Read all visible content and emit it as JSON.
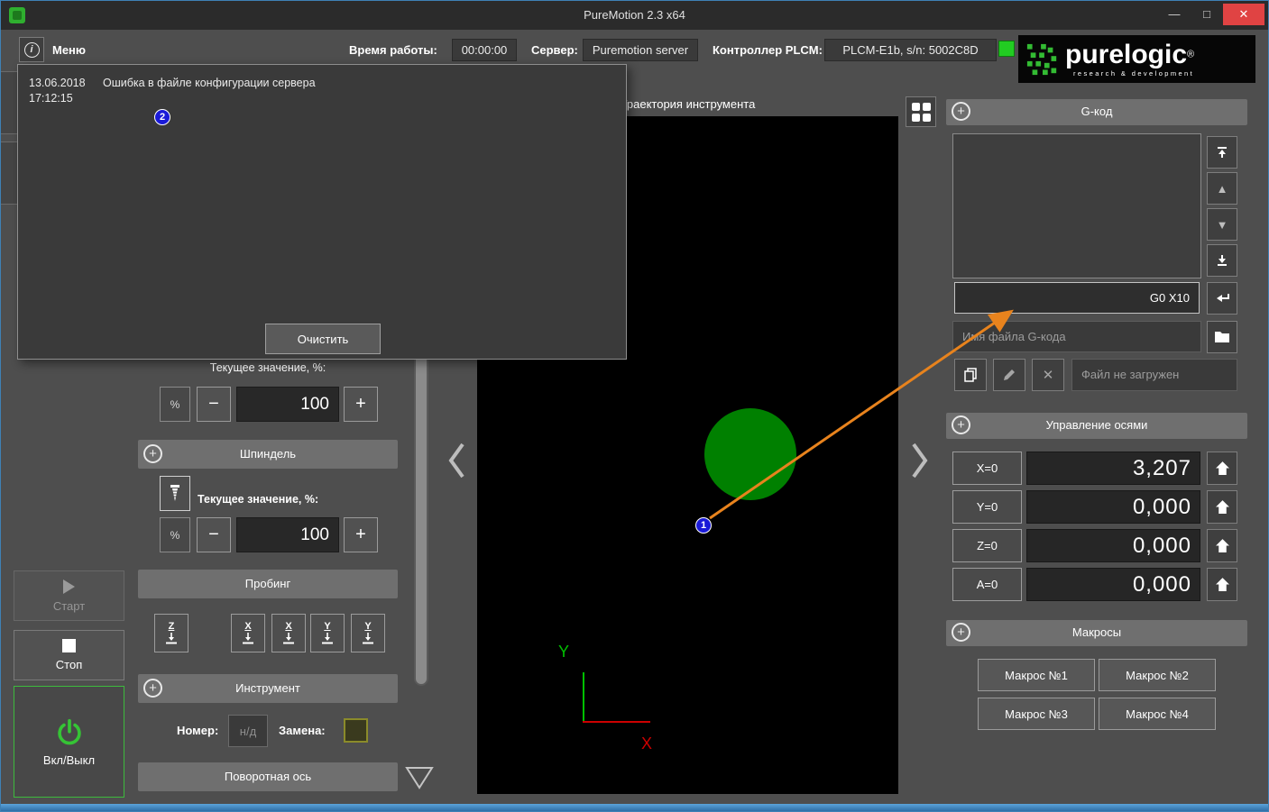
{
  "window": {
    "title": "PureMotion 2.3 x64",
    "controls": {
      "minimize": "—",
      "maximize": "□",
      "close": "✕"
    }
  },
  "icons": {
    "plus": "+",
    "minus": "−",
    "info": "i",
    "up_triangle": "▲",
    "down_triangle": "▼",
    "x_mark": "✕"
  },
  "topbar": {
    "menu_label": "Меню",
    "uptime_label": "Время работы:",
    "uptime_value": "00:00:00",
    "server_label": "Сервер:",
    "server_value": "Puremotion server",
    "controller_label": "Контроллер PLCM:",
    "controller_value": "PLCM-E1b, s/n: 5002C8D"
  },
  "logo": {
    "wordmark": "purelogic",
    "reg": "®",
    "subtitle": "research & development"
  },
  "log_panel": {
    "entry_date": "13.06.2018",
    "entry_time": "17:12:15",
    "entry_text": "Ошибка в файле конфигурации сервера",
    "clear_button": "Очистить"
  },
  "viewport": {
    "title": "Траектория инструмента",
    "x_axis": "X",
    "y_axis": "Y"
  },
  "left_panel": {
    "feed": {
      "current_label": "Текущее значение, %:",
      "unit": "%",
      "value": "100"
    },
    "spindle": {
      "title": "Шпиндель",
      "current_label": "Текущее значение, %:",
      "unit": "%",
      "value": "100"
    },
    "probing": {
      "title": "Пробинг",
      "buttons": [
        "Z",
        "X",
        "X",
        "Y",
        "Y"
      ]
    },
    "tool": {
      "title": "Инструмент",
      "number_label": "Номер:",
      "number_value": "н/д",
      "replace_label": "Замена:"
    },
    "rotary": {
      "title": "Поворотная ось"
    }
  },
  "controls": {
    "start": "Старт",
    "stop": "Стоп",
    "power": "Вкл/Выкл"
  },
  "gcode_panel": {
    "title": "G-код",
    "input_value": "G0 X10",
    "filename_placeholder": "Имя файла G-кода",
    "file_status": "Файл не загружен"
  },
  "axes_panel": {
    "title": "Управление осями",
    "axes": [
      {
        "zero": "X=0",
        "value": "3,207"
      },
      {
        "zero": "Y=0",
        "value": "0,000"
      },
      {
        "zero": "Z=0",
        "value": "0,000"
      },
      {
        "zero": "A=0",
        "value": "0,000"
      }
    ]
  },
  "macros_panel": {
    "title": "Макросы",
    "buttons": [
      "Макрос №1",
      "Макрос №2",
      "Макрос №3",
      "Макрос №4"
    ]
  },
  "annotations": {
    "one": "1",
    "two": "2"
  }
}
